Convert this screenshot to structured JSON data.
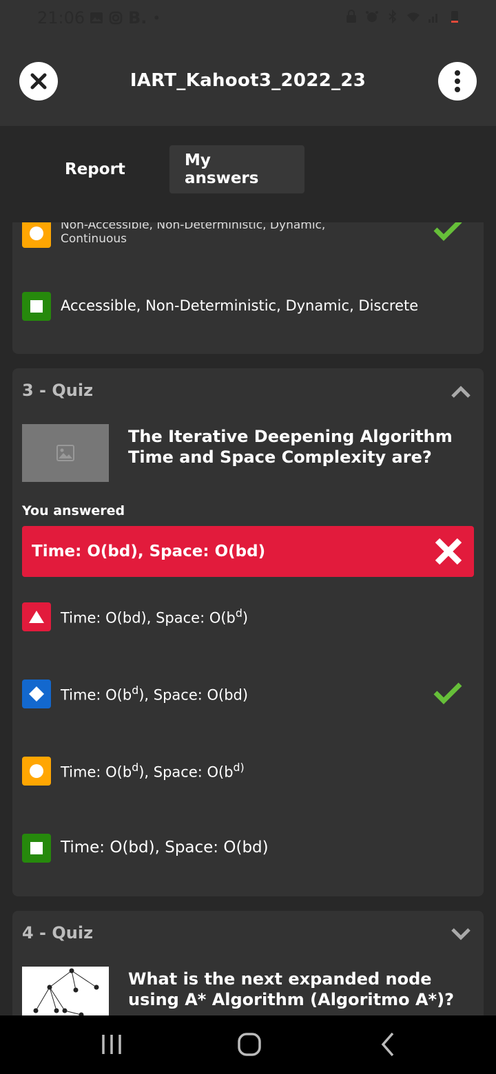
{
  "status_bar": {
    "time": "21:06",
    "b_label": "B.",
    "dot": "•"
  },
  "header": {
    "title": "IART_Kahoot3_2022_23"
  },
  "tabs": [
    {
      "label": "Report"
    },
    {
      "label": "My answers"
    }
  ],
  "q2_partial": {
    "answers": [
      {
        "text_line1": "Non-Accessible, Non-Deterministic, Dynamic,",
        "text_line2": "Continuous",
        "correct": true
      },
      {
        "text": "Accessible, Non-Deterministic, Dynamic, Discrete",
        "correct": false
      }
    ]
  },
  "q3": {
    "header": "3 - Quiz",
    "question": "The Iterative Deepening Algorithm Time and Space Complexity are?",
    "you_answered_label": "You answered",
    "your_answer": "Time: O(bd), Space: O(bd)",
    "answers": [
      {
        "pre": "Time: O(bd), Space: O(b",
        "sup": "d",
        "post": ")",
        "correct": false
      },
      {
        "pre": "Time: O(b",
        "sup": "d",
        "post": "), Space: O(bd)",
        "correct": true
      },
      {
        "pre": "Time: O(b",
        "sup": "d",
        "post": "), Space: O(b",
        "sup2": "d)",
        "correct": false
      },
      {
        "text": "Time: O(bd), Space: O(bd)",
        "correct": false
      }
    ]
  },
  "q4": {
    "header": "4 - Quiz",
    "question": "What is the next expanded node using A* Algorithm (Algoritmo A*)?"
  },
  "colors": {
    "red": "#e21b3c",
    "blue": "#1368ce",
    "yellow": "#ffa602",
    "green": "#26890c",
    "check": "#66bf39"
  }
}
